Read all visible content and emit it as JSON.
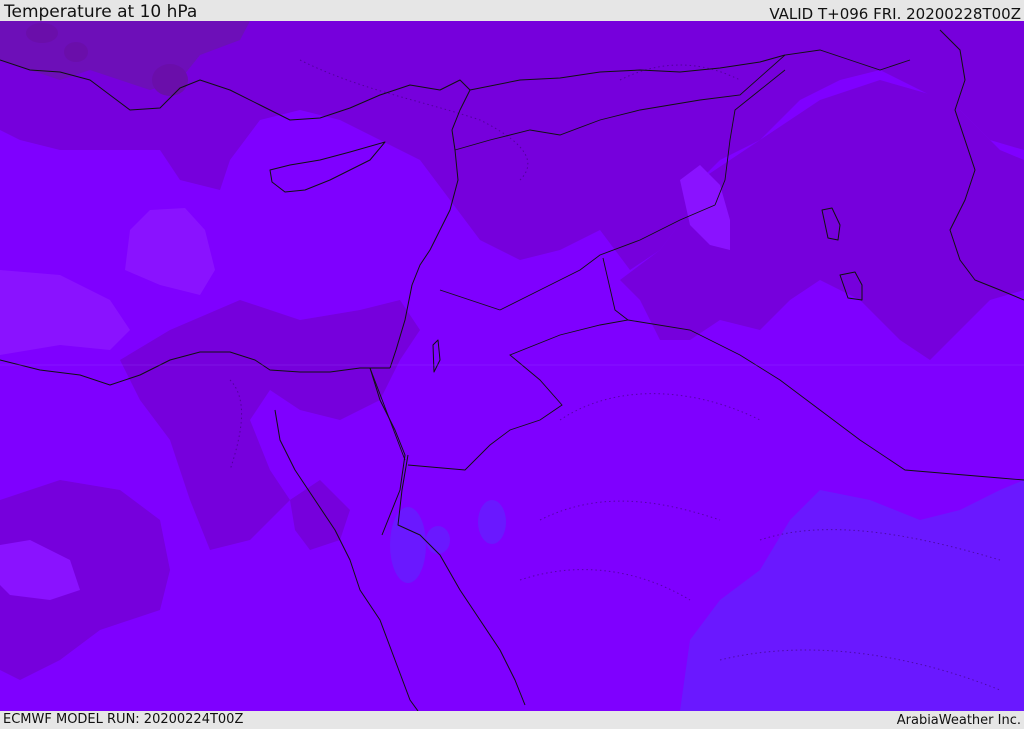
{
  "header": {
    "title": "Temperature at 10 hPa",
    "valid": "VALID T+096 FRI. 20200228T00Z"
  },
  "footer": {
    "model_run": "ECMWF MODEL RUN: 20200224T00Z",
    "credit": "ArabiaWeather Inc."
  },
  "map": {
    "colors": {
      "base": "#7f00ff",
      "darker_band": "#7600dc",
      "darkest_band": "#6d0fb8",
      "light_band": "#8a12ff",
      "blue_band": "#6a18ff",
      "coast": "#111111"
    }
  }
}
